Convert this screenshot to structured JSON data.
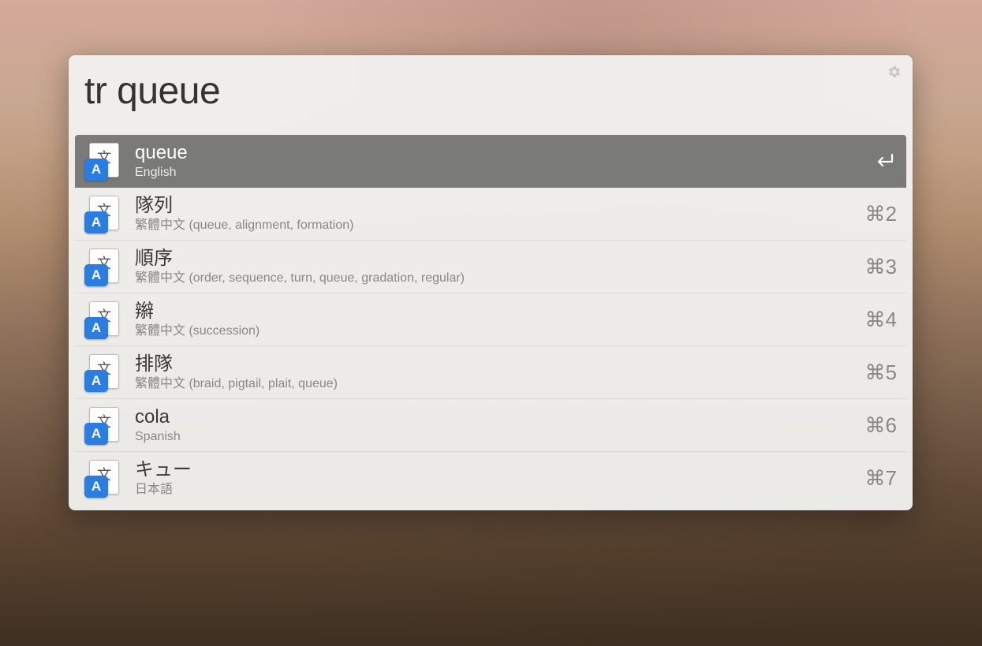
{
  "search": {
    "value": "tr queue"
  },
  "results": [
    {
      "title": "queue",
      "subtitle": "English",
      "shortcut": "",
      "selected": true,
      "showEnter": true
    },
    {
      "title": "隊列",
      "subtitle": "繁體中文 (queue, alignment, formation)",
      "shortcut": "⌘2",
      "selected": false,
      "showEnter": false
    },
    {
      "title": "順序",
      "subtitle": "繁體中文 (order, sequence, turn, queue, gradation, regular)",
      "shortcut": "⌘3",
      "selected": false,
      "showEnter": false
    },
    {
      "title": "辮",
      "subtitle": "繁體中文 (succession)",
      "shortcut": "⌘4",
      "selected": false,
      "showEnter": false
    },
    {
      "title": "排隊",
      "subtitle": "繁體中文 (braid, pigtail, plait, queue)",
      "shortcut": "⌘5",
      "selected": false,
      "showEnter": false
    },
    {
      "title": "cola",
      "subtitle": "Spanish",
      "shortcut": "⌘6",
      "selected": false,
      "showEnter": false
    },
    {
      "title": "キュー",
      "subtitle": "日本語",
      "shortcut": "⌘7",
      "selected": false,
      "showEnter": false
    }
  ]
}
